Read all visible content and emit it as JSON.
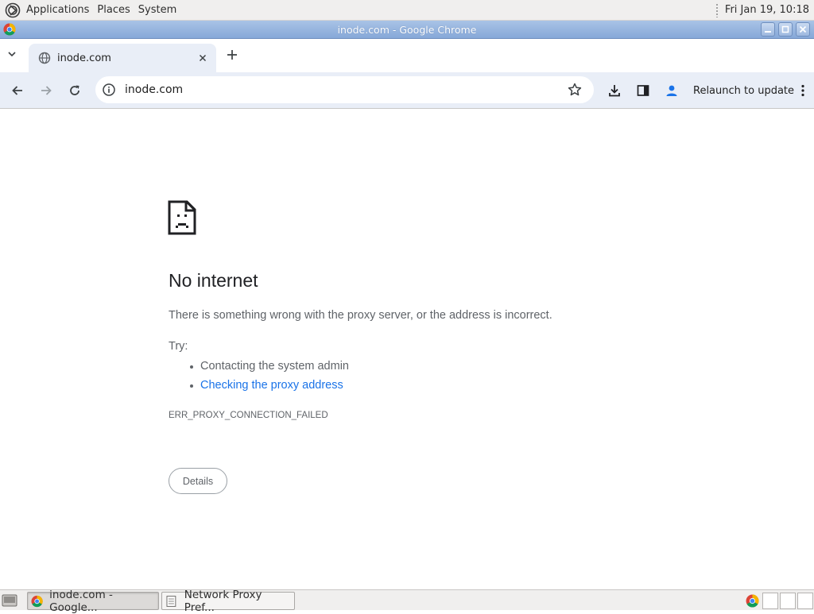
{
  "top_panel": {
    "menus": [
      "Applications",
      "Places",
      "System"
    ],
    "clock": "Fri Jan 19, 10:18"
  },
  "window": {
    "title": "inode.com - Google Chrome"
  },
  "tab": {
    "title": "inode.com"
  },
  "omnibox": {
    "url": "inode.com"
  },
  "toolbar": {
    "relaunch_label": "Relaunch to update"
  },
  "error_page": {
    "title": "No internet",
    "description": "There is something wrong with the proxy server, or the address is incorrect.",
    "try_label": "Try:",
    "suggestions": [
      "Contacting the system admin",
      "Checking the proxy address"
    ],
    "error_code": "ERR_PROXY_CONNECTION_FAILED",
    "details_label": "Details"
  },
  "taskbar": {
    "tasks": [
      "inode.com - Google...",
      "Network Proxy Pref..."
    ]
  },
  "colors": {
    "link": "#1a73e8",
    "body_text": "#5f6368",
    "heading_text": "#202124",
    "toolbar_bg": "#e9eef7",
    "title_bar": "#86a8d8"
  }
}
